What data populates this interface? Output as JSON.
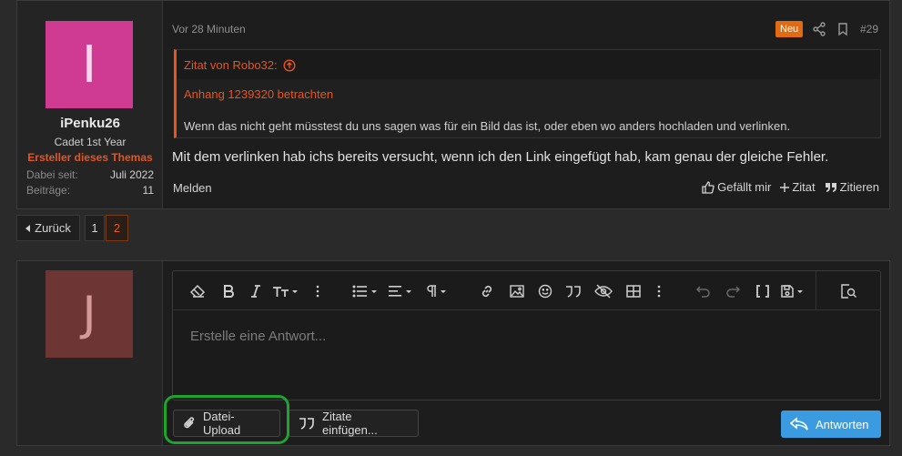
{
  "post": {
    "avatar_letter": "I",
    "avatar_color": "#cf3a93",
    "username": "iPenku26",
    "user_title": "Cadet 1st Year",
    "user_badge": "Ersteller dieses Themas",
    "stats": [
      {
        "label": "Dabei seit:",
        "value": "Juli 2022"
      },
      {
        "label": "Beiträge:",
        "value": "11"
      }
    ],
    "time": "Vor 28 Minuten",
    "new_badge": "Neu",
    "post_number": "#29",
    "quote": {
      "header": "Zitat von Robo32:",
      "attachment": "Anhang 1239320 betrachten",
      "text": "Wenn das nicht geht müsstest du uns sagen was für ein Bild das ist, oder eben wo anders hochladen und verlinken."
    },
    "message": "Mit dem verlinken hab ichs bereits versucht, wenn ich den Link eingefügt hab, kam genau der gleiche Fehler.",
    "report_label": "Melden",
    "actions": {
      "like": "Gefällt mir",
      "quote": "Zitat",
      "multiquote": "Zitieren"
    }
  },
  "pagination": {
    "prev": "Zurück",
    "pages": [
      "1",
      "2"
    ],
    "current": "2"
  },
  "reply": {
    "avatar_letter": "J",
    "avatar_color": "#6e3535",
    "placeholder": "Erstelle eine Antwort...",
    "upload_label": "Datei-Upload",
    "insert_quotes_label": "Zitate einfügen...",
    "submit_label": "Antworten",
    "accent_color": "#3b9be0"
  },
  "colors": {
    "brand": "#e9541e",
    "highlight_ring": "#1ea32e"
  }
}
